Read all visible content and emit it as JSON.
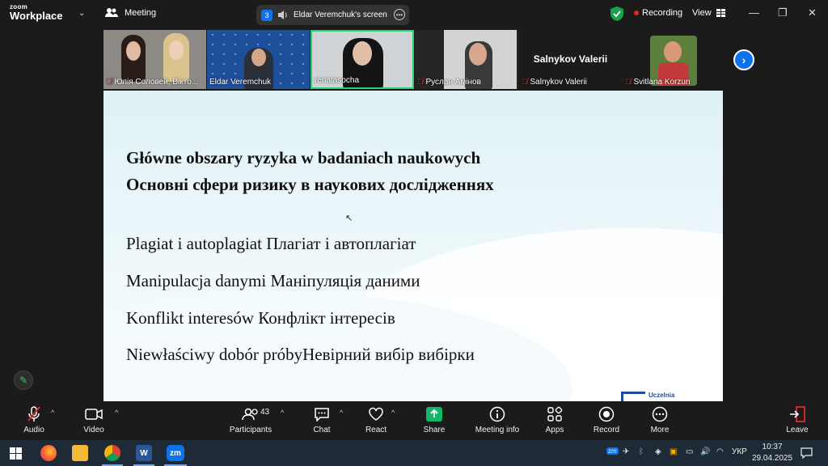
{
  "titlebar": {
    "logo_line1": "zoom",
    "logo_line2": "Workplace",
    "meeting_label": "Meeting",
    "share_count": "3",
    "share_label": "Eldar Veremchuk's screen",
    "recording_label": "Recording",
    "view_label": "View"
  },
  "gallery": {
    "tiles": [
      {
        "name": "Юлія Соловей, Вікто..."
      },
      {
        "name": "Eldar Veremchuk"
      },
      {
        "name": "renatasocha"
      },
      {
        "name": "Руслан Амінов"
      },
      {
        "name": "Salnykov Valerii",
        "center_name": "Salnykov Valerii"
      },
      {
        "name": "Svitlana Korzun"
      }
    ]
  },
  "slide": {
    "title_line1": "Główne obszary ryzyka w badaniach naukowych",
    "title_line2": "Основні сфери ризику в наукових дослідженнях",
    "items": [
      "Plagiat i autoplagiat Плагіат і автоплагіат",
      "Manipulacja danymi Маніпуляція даними",
      "Konflikt interesów Конфлікт інтересів",
      "Niewłaściwy dobór próbyНевірний вибір вибірки"
    ],
    "logo_text": "Uczelnia"
  },
  "toolbar": {
    "audio": "Audio",
    "video": "Video",
    "participants": "Participants",
    "participants_count": "43",
    "chat": "Chat",
    "react": "React",
    "share": "Share",
    "meeting_info": "Meeting info",
    "apps": "Apps",
    "record": "Record",
    "more": "More",
    "leave": "Leave"
  },
  "taskbar": {
    "zm_label": "zm",
    "lang": "УКР",
    "time": "10:37",
    "date": "29.04.2025"
  },
  "colors": {
    "accent": "#0e72ed",
    "share_green": "#12b76a",
    "leave_red": "#e02828",
    "active_speaker": "#2bcf6f"
  }
}
